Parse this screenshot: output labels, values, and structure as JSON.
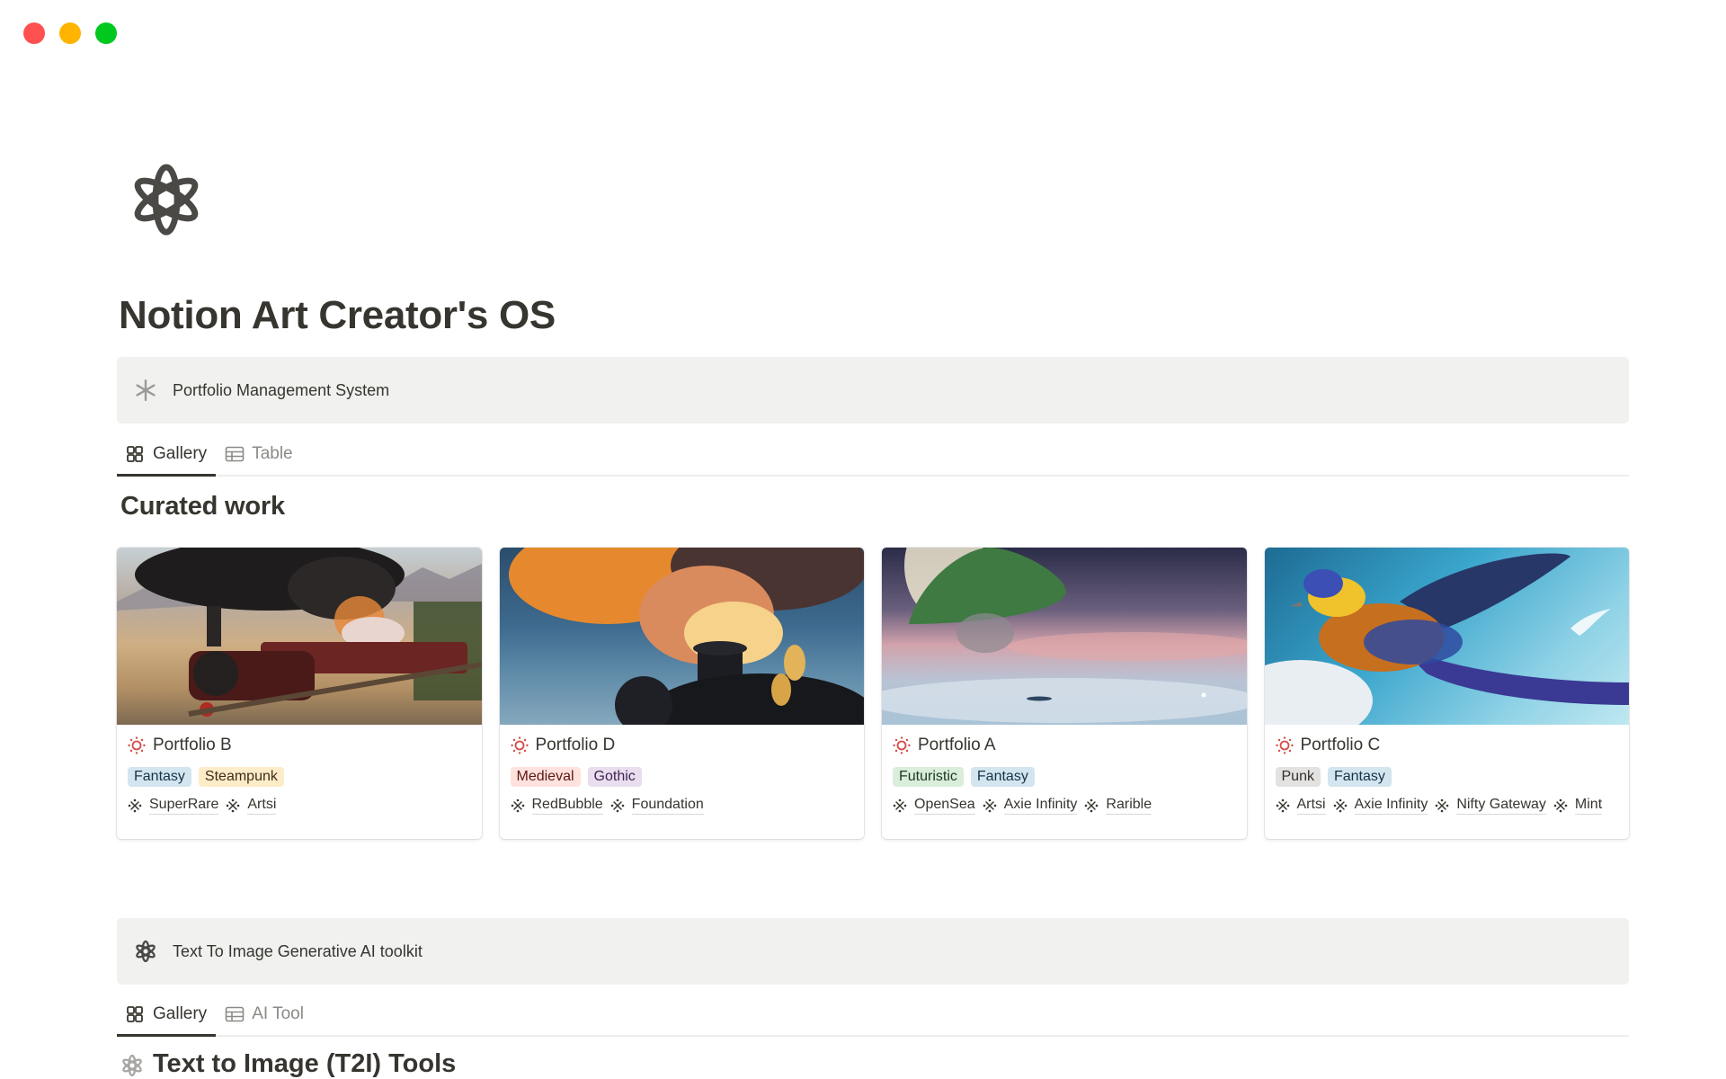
{
  "window": {
    "controls": [
      "close",
      "minimize",
      "maximize"
    ]
  },
  "page": {
    "icon": "atom-icon",
    "title": "Notion Art Creator's OS"
  },
  "sections": [
    {
      "callout": {
        "icon": "asterisk-icon",
        "text": "Portfolio Management System"
      },
      "tabs": [
        {
          "label": "Gallery",
          "icon": "gallery-grid-icon",
          "active": true
        },
        {
          "label": "Table",
          "icon": "table-icon",
          "active": false
        }
      ],
      "heading": "Curated work",
      "cards": [
        {
          "title": "Portfolio B",
          "icon": "sun-icon",
          "cover": "steam train in desert landscape",
          "tags": [
            {
              "label": "Fantasy",
              "bg": "#d3e5ef",
              "fg": "#183347"
            },
            {
              "label": "Steampunk",
              "bg": "#fdecc8",
              "fg": "#402c1b"
            }
          ],
          "links": [
            "SuperRare",
            "Artsi"
          ]
        },
        {
          "title": "Portfolio D",
          "icon": "sun-icon",
          "cover": "locomotive with orange smoke",
          "tags": [
            {
              "label": "Medieval",
              "bg": "#ffe2dd",
              "fg": "#5d1715"
            },
            {
              "label": "Gothic",
              "bg": "#e8deee",
              "fg": "#412454"
            }
          ],
          "links": [
            "RedBubble",
            "Foundation"
          ]
        },
        {
          "title": "Portfolio A",
          "icon": "sun-icon",
          "cover": "floating green mushroom in pastel sky",
          "tags": [
            {
              "label": "Futuristic",
              "bg": "#dbeddb",
              "fg": "#1c3829"
            },
            {
              "label": "Fantasy",
              "bg": "#d3e5ef",
              "fg": "#183347"
            }
          ],
          "links": [
            "OpenSea",
            "Axie Infinity",
            "Rarible"
          ]
        },
        {
          "title": "Portfolio C",
          "icon": "sun-icon",
          "cover": "colorful bird flying in blue sky",
          "tags": [
            {
              "label": "Punk",
              "bg": "#e3e2e0",
              "fg": "#32302c"
            },
            {
              "label": "Fantasy",
              "bg": "#d3e5ef",
              "fg": "#183347"
            }
          ],
          "links": [
            "Artsi",
            "Axie Infinity",
            "Nifty Gateway",
            "Mint"
          ]
        }
      ]
    },
    {
      "callout": {
        "icon": "atom-icon",
        "text": "Text To Image Generative AI toolkit"
      },
      "tabs": [
        {
          "label": "Gallery",
          "icon": "gallery-grid-icon",
          "active": true
        },
        {
          "label": "AI Tool",
          "icon": "table-icon",
          "active": false
        }
      ],
      "heading": "Text to Image (T2I) Tools"
    }
  ],
  "colors": {
    "text": "#37352f",
    "callout_bg": "#f1f1ef",
    "sun_icon": "#d44c47"
  }
}
